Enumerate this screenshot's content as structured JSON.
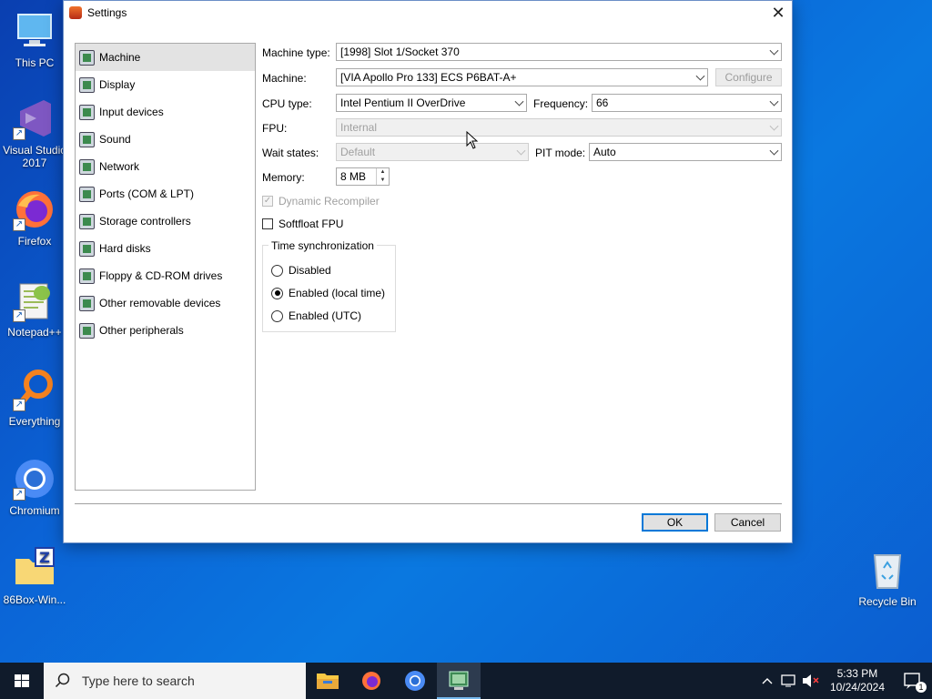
{
  "desktop": {
    "icons": [
      {
        "label": "This PC"
      },
      {
        "label": "Visual Studio 2017"
      },
      {
        "label": "Firefox"
      },
      {
        "label": "Notepad++"
      },
      {
        "label": "Everything"
      },
      {
        "label": "Chromium"
      },
      {
        "label": "86Box-Win..."
      },
      {
        "label": "Recycle Bin"
      }
    ]
  },
  "window": {
    "title": "Settings",
    "close_glyph": "✕",
    "nav": [
      {
        "label": "Machine",
        "icon": "motherboard-icon",
        "selected": true
      },
      {
        "label": "Display",
        "icon": "display-icon"
      },
      {
        "label": "Input devices",
        "icon": "keyboard-icon"
      },
      {
        "label": "Sound",
        "icon": "speaker-icon"
      },
      {
        "label": "Network",
        "icon": "network-icon"
      },
      {
        "label": "Ports (COM & LPT)",
        "icon": "ports-icon"
      },
      {
        "label": "Storage controllers",
        "icon": "storage-icon"
      },
      {
        "label": "Hard disks",
        "icon": "hard-disk-icon"
      },
      {
        "label": "Floppy & CD-ROM drives",
        "icon": "floppy-icon"
      },
      {
        "label": "Other removable devices",
        "icon": "removable-icon"
      },
      {
        "label": "Other peripherals",
        "icon": "peripherals-icon"
      }
    ],
    "form": {
      "machine_type_label": "Machine type:",
      "machine_type_value": "[1998] Slot 1/Socket 370",
      "machine_label": "Machine:",
      "machine_value": "[VIA Apollo Pro 133] ECS P6BAT-A+",
      "configure_label": "Configure",
      "cpu_type_label": "CPU type:",
      "cpu_type_value": "Intel Pentium II OverDrive",
      "frequency_label": "Frequency:",
      "frequency_value": "66",
      "fpu_label": "FPU:",
      "fpu_value": "Internal",
      "wait_states_label": "Wait states:",
      "wait_states_value": "Default",
      "pit_mode_label": "PIT mode:",
      "pit_mode_value": "Auto",
      "memory_label": "Memory:",
      "memory_value": "8 MB",
      "dynamic_recompiler_label": "Dynamic Recompiler",
      "dynamic_recompiler_checked": true,
      "softfloat_label": "Softfloat FPU",
      "softfloat_checked": false,
      "time_sync": {
        "title": "Time synchronization",
        "options": [
          {
            "label": "Disabled",
            "selected": false
          },
          {
            "label": "Enabled (local time)",
            "selected": true
          },
          {
            "label": "Enabled (UTC)",
            "selected": false
          }
        ]
      }
    },
    "buttons": {
      "ok": "OK",
      "cancel": "Cancel"
    }
  },
  "taskbar": {
    "search_placeholder": "Type here to search",
    "apps": [
      "file-explorer-icon",
      "firefox-icon",
      "chromium-icon",
      "86box-icon"
    ],
    "clock_time": "5:33 PM",
    "clock_date": "10/24/2024",
    "notification_count": "1"
  }
}
